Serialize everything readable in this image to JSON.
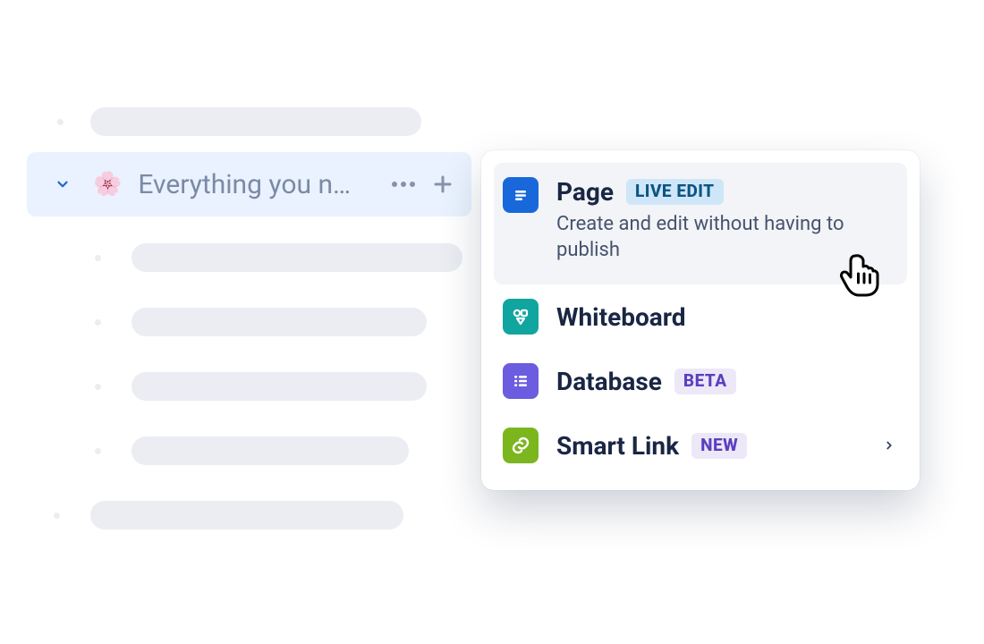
{
  "sidebar": {
    "selected": {
      "emoji": "🌸",
      "title": "Everything you n…"
    }
  },
  "menu": {
    "items": [
      {
        "title": "Page",
        "badge": "LIVE EDIT",
        "desc": "Create and edit without having to publish"
      },
      {
        "title": "Whiteboard"
      },
      {
        "title": "Database",
        "badge": "BETA"
      },
      {
        "title": "Smart Link",
        "badge": "NEW"
      }
    ]
  }
}
